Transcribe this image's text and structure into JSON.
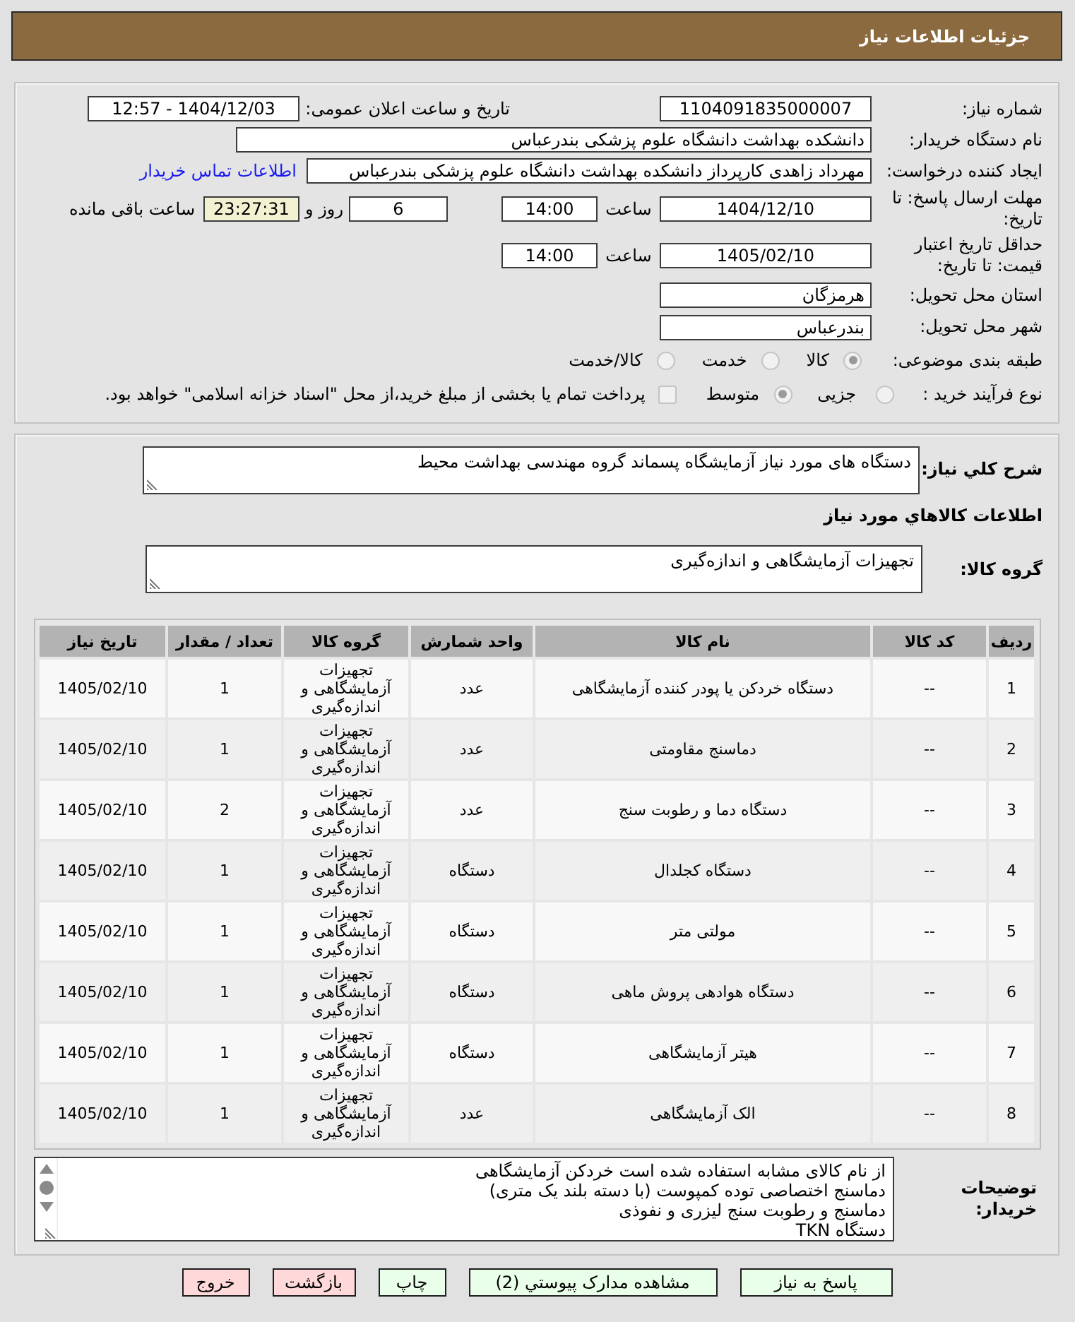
{
  "header": {
    "title": "جزئیات اطلاعات نیاز"
  },
  "details": {
    "need_number": {
      "label": "شماره نیاز:",
      "value": "1104091835000007"
    },
    "announce": {
      "label": "تاریخ و ساعت اعلان عمومی:",
      "value": "1404/12/03 - 12:57"
    },
    "buyer_org": {
      "label": "نام دستگاه خریدار:",
      "value": "دانشکده بهداشت دانشگاه علوم پزشکی بندرعباس"
    },
    "requester": {
      "label": "ایجاد کننده درخواست:",
      "value": "مهرداد زاهدی کارپرداز دانشکده بهداشت دانشگاه علوم پزشکی بندرعباس",
      "link": "اطلاعات تماس خریدار"
    },
    "deadline": {
      "label": "مهلت ارسال پاسخ: تا تاریخ:",
      "date": "1404/12/10",
      "time_label": "ساعت",
      "time": "14:00",
      "days": "6",
      "days_label": "روز و",
      "remaining": "23:27:31",
      "remaining_label": "ساعت باقی مانده"
    },
    "validity": {
      "label": "حداقل تاریخ اعتبار قیمت: تا تاریخ:",
      "date": "1405/02/10",
      "time_label": "ساعت",
      "time": "14:00"
    },
    "province": {
      "label": "استان محل تحویل:",
      "value": "هرمزگان"
    },
    "city": {
      "label": "شهر محل تحویل:",
      "value": "بندرعباس"
    },
    "category": {
      "label": "طبقه بندی موضوعی:",
      "options": [
        {
          "label": "کالا",
          "selected": true
        },
        {
          "label": "خدمت",
          "selected": false
        },
        {
          "label": "کالا/خدمت",
          "selected": false
        }
      ]
    },
    "process": {
      "label": "نوع فرآیند خرید :",
      "options": [
        {
          "label": "جزیی",
          "selected": false
        },
        {
          "label": "متوسط",
          "selected": true
        }
      ],
      "treasury": {
        "label": "پرداخت تمام یا بخشی از مبلغ خرید،از محل \"اسناد خزانه اسلامی\" خواهد بود.",
        "checked": false
      }
    }
  },
  "description": {
    "label": "شرح کلي نیاز:",
    "value": "دستگاه های مورد نیاز آزمایشگاه پسماند گروه مهندسی بهداشت محیط"
  },
  "goods": {
    "title": "اطلاعات کالاهاي مورد نیاز",
    "group_label": "گروه کالا:",
    "group_value": "تجهیزات آزمایشگاهی و اندازه‌گیری"
  },
  "table": {
    "columns": [
      "ردیف",
      "کد کالا",
      "نام کالا",
      "واحد شمارش",
      "گروه کالا",
      "تعداد / مقدار",
      "تاریخ نیاز"
    ],
    "rows": [
      [
        "1",
        "--",
        "دستگاه خردکن یا پودر کننده آزمایشگاهی",
        "عدد",
        "تجهیزات آزمایشگاهی و اندازه‌گیری",
        "1",
        "1405/02/10"
      ],
      [
        "2",
        "--",
        "دماسنج مقاومتی",
        "عدد",
        "تجهیزات آزمایشگاهی و اندازه‌گیری",
        "1",
        "1405/02/10"
      ],
      [
        "3",
        "--",
        "دستگاه دما و رطوبت سنج",
        "عدد",
        "تجهیزات آزمایشگاهی و اندازه‌گیری",
        "2",
        "1405/02/10"
      ],
      [
        "4",
        "--",
        "دستگاه کجلدال",
        "دستگاه",
        "تجهیزات آزمایشگاهی و اندازه‌گیری",
        "1",
        "1405/02/10"
      ],
      [
        "5",
        "--",
        "مولتی متر",
        "دستگاه",
        "تجهیزات آزمایشگاهی و اندازه‌گیری",
        "1",
        "1405/02/10"
      ],
      [
        "6",
        "--",
        "دستگاه هوادهی پروش ماهی",
        "دستگاه",
        "تجهیزات آزمایشگاهی و اندازه‌گیری",
        "1",
        "1405/02/10"
      ],
      [
        "7",
        "--",
        "هیتر آزمایشگاهی",
        "دستگاه",
        "تجهیزات آزمایشگاهی و اندازه‌گیری",
        "1",
        "1405/02/10"
      ],
      [
        "8",
        "--",
        "الک آزمایشگاهی",
        "عدد",
        "تجهیزات آزمایشگاهی و اندازه‌گیری",
        "1",
        "1405/02/10"
      ]
    ]
  },
  "buyer_notes": {
    "label": "توضیحات خریدار:",
    "lines": [
      "از نام کالای مشابه استفاده شده است خردکن آزمایشگاهی",
      "دماسنج اختصاصی توده کمپوست (با دسته بلند یک متری)",
      "دماسنج و رطوبت سنج لیزری و نفوذی",
      "دستگاه TKN"
    ]
  },
  "buttons": [
    {
      "label": "پاسخ به نیاز",
      "kind": "action"
    },
    {
      "label": "مشاهده مدارک پیوستي (2)",
      "kind": "action"
    },
    {
      "label": "چاپ",
      "kind": "action"
    },
    {
      "label": "بازگشت",
      "kind": "cancel"
    },
    {
      "label": "خروج",
      "kind": "cancel"
    }
  ]
}
